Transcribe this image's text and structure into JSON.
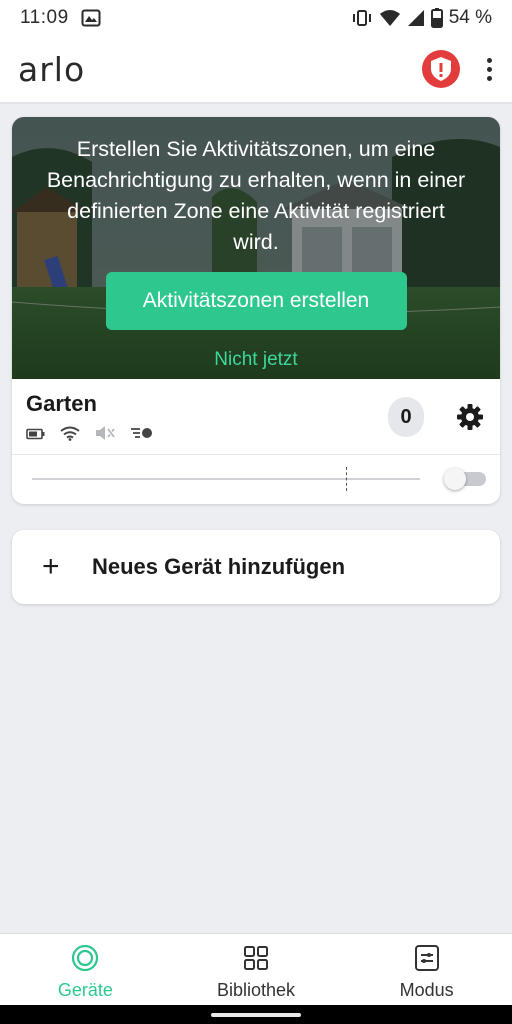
{
  "status_bar": {
    "time": "11:09",
    "battery": "54 %",
    "icons": [
      "gallery-icon",
      "vibrate-icon",
      "wifi-icon",
      "signal-icon",
      "battery-icon"
    ]
  },
  "header": {
    "logo": "arlo",
    "alert_icon": "alert-shield-icon",
    "menu_icon": "kebab-menu-icon"
  },
  "camera_card": {
    "prompt": "Erstellen Sie Aktivitätszonen, um eine Benachrichtigung zu erhalten, wenn in einer definierten Zone eine Aktivität registriert wird.",
    "cta_label": "Aktivitätszonen erstellen",
    "dismiss_label": "Nicht jetzt",
    "device_name": "Garten",
    "event_count": "0",
    "status_icons": [
      "battery-icon",
      "wifi-icon",
      "speaker-muted-icon",
      "motion-sensitivity-icon"
    ],
    "toggle_on": false
  },
  "add_device": {
    "plus": "+",
    "label": "Neues Gerät hinzufügen"
  },
  "bottom_nav": {
    "items": [
      {
        "label": "Geräte",
        "icon": "devices-icon",
        "active": true
      },
      {
        "label": "Bibliothek",
        "icon": "library-grid-icon",
        "active": false
      },
      {
        "label": "Modus",
        "icon": "mode-sliders-icon",
        "active": false
      }
    ]
  },
  "colors": {
    "accent": "#2ec88f",
    "alert": "#e23c3c",
    "background": "#eceef2"
  }
}
